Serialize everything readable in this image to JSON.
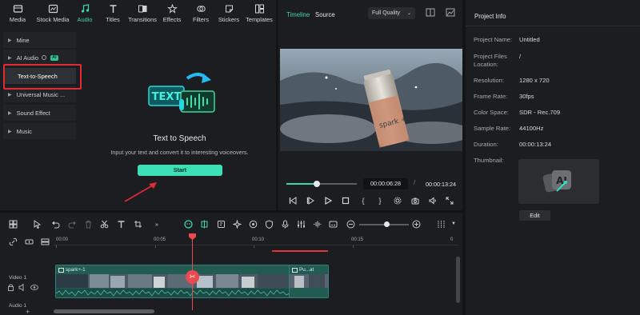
{
  "media_tabs": [
    {
      "label": "Media",
      "icon": "media-icon"
    },
    {
      "label": "Stock Media",
      "icon": "stock-media-icon"
    },
    {
      "label": "Audio",
      "icon": "audio-icon"
    },
    {
      "label": "Titles",
      "icon": "titles-icon"
    },
    {
      "label": "Transitions",
      "icon": "transitions-icon"
    },
    {
      "label": "Effects",
      "icon": "effects-icon"
    },
    {
      "label": "Filters",
      "icon": "filters-icon"
    },
    {
      "label": "Stickers",
      "icon": "stickers-icon"
    },
    {
      "label": "Templates",
      "icon": "templates-icon"
    }
  ],
  "active_tab": "Audio",
  "sidebar": {
    "items": [
      {
        "label": "Mine"
      },
      {
        "label": "AI Audio",
        "badge": "AI"
      },
      {
        "label": "Text-to-Speech"
      },
      {
        "label": "Universal Music ..."
      },
      {
        "label": "Sound Effect"
      },
      {
        "label": "Music"
      }
    ]
  },
  "tts": {
    "illustration_text": "TEXT",
    "title": "Text to Speech",
    "description": "Input your text and convert it to interesting voiceovers.",
    "start_label": "Start"
  },
  "preview": {
    "tab_timeline": "Timeline",
    "tab_source": "Source",
    "quality": "Full Quality",
    "video_text": "spark +",
    "current_time": "00:00:06:28",
    "separator": "/",
    "total_time": "00:00:13:24",
    "progress_fraction": 0.43
  },
  "project_info": {
    "title": "Project Info",
    "fields": [
      {
        "label": "Project Name:",
        "value": "Untitled"
      },
      {
        "label": "Project Files\nLocation:",
        "value": "/"
      },
      {
        "label": "Resolution:",
        "value": "1280 x 720"
      },
      {
        "label": "Frame Rate:",
        "value": "30fps"
      },
      {
        "label": "Color Space:",
        "value": "SDR - Rec.709"
      },
      {
        "label": "Sample Rate:",
        "value": "44100Hz"
      },
      {
        "label": "Duration:",
        "value": "00:00:13:24"
      },
      {
        "label": "Thumbnail:",
        "value": ""
      }
    ],
    "thumbnail_text": "AI",
    "edit_label": "Edit"
  },
  "timeline": {
    "ruler": [
      "00:00",
      "00:05",
      "00:10",
      "00:15",
      "0"
    ],
    "tracks": [
      {
        "label": "Video 1"
      },
      {
        "label": "Audio 1"
      }
    ],
    "clips": [
      {
        "label": "spark+-1"
      },
      {
        "label": "Pu...at"
      }
    ],
    "zoom_fraction": 0.55
  },
  "colors": {
    "accent": "#3fd6b3",
    "highlight": "#e02b33",
    "playhead": "#e84a50"
  }
}
